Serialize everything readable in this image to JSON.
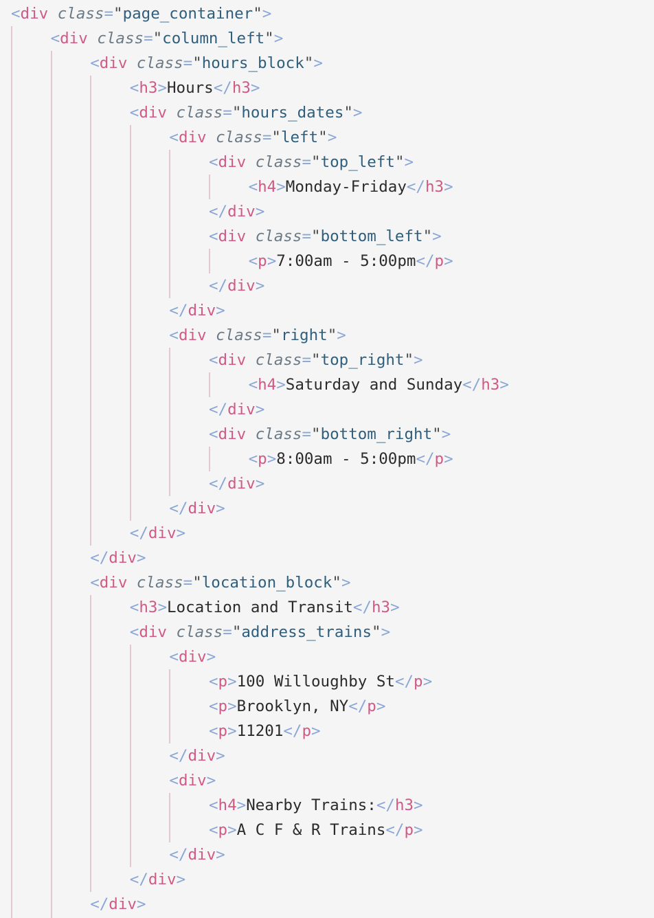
{
  "lines": [
    {
      "indent": 0,
      "tokens": [
        [
          "p",
          "<"
        ],
        [
          "t",
          "div"
        ],
        [
          "x",
          " "
        ],
        [
          "a",
          "class"
        ],
        [
          "p",
          "="
        ],
        [
          "q",
          "\""
        ],
        [
          "v",
          "page_container"
        ],
        [
          "q",
          "\""
        ],
        [
          "p",
          ">"
        ]
      ]
    },
    {
      "indent": 1,
      "tokens": [
        [
          "p",
          "<"
        ],
        [
          "t",
          "div"
        ],
        [
          "x",
          " "
        ],
        [
          "a",
          "class"
        ],
        [
          "p",
          "="
        ],
        [
          "q",
          "\""
        ],
        [
          "v",
          "column_left"
        ],
        [
          "q",
          "\""
        ],
        [
          "p",
          ">"
        ]
      ]
    },
    {
      "indent": 2,
      "tokens": [
        [
          "p",
          "<"
        ],
        [
          "t",
          "div"
        ],
        [
          "x",
          " "
        ],
        [
          "a",
          "class"
        ],
        [
          "p",
          "="
        ],
        [
          "q",
          "\""
        ],
        [
          "v",
          "hours_block"
        ],
        [
          "q",
          "\""
        ],
        [
          "p",
          ">"
        ]
      ]
    },
    {
      "indent": 3,
      "tokens": [
        [
          "p",
          "<"
        ],
        [
          "t",
          "h3"
        ],
        [
          "p",
          ">"
        ],
        [
          "x",
          "Hours"
        ],
        [
          "p",
          "</"
        ],
        [
          "t",
          "h3"
        ],
        [
          "p",
          ">"
        ]
      ]
    },
    {
      "indent": 3,
      "tokens": [
        [
          "p",
          "<"
        ],
        [
          "t",
          "div"
        ],
        [
          "x",
          " "
        ],
        [
          "a",
          "class"
        ],
        [
          "p",
          "="
        ],
        [
          "q",
          "\""
        ],
        [
          "v",
          "hours_dates"
        ],
        [
          "q",
          "\""
        ],
        [
          "p",
          ">"
        ]
      ]
    },
    {
      "indent": 4,
      "tokens": [
        [
          "p",
          "<"
        ],
        [
          "t",
          "div"
        ],
        [
          "x",
          " "
        ],
        [
          "a",
          "class"
        ],
        [
          "p",
          "="
        ],
        [
          "q",
          "\""
        ],
        [
          "v",
          "left"
        ],
        [
          "q",
          "\""
        ],
        [
          "p",
          ">"
        ]
      ]
    },
    {
      "indent": 5,
      "tokens": [
        [
          "p",
          "<"
        ],
        [
          "t",
          "div"
        ],
        [
          "x",
          " "
        ],
        [
          "a",
          "class"
        ],
        [
          "p",
          "="
        ],
        [
          "q",
          "\""
        ],
        [
          "v",
          "top_left"
        ],
        [
          "q",
          "\""
        ],
        [
          "p",
          ">"
        ]
      ]
    },
    {
      "indent": 6,
      "tokens": [
        [
          "p",
          "<"
        ],
        [
          "t",
          "h4"
        ],
        [
          "p",
          ">"
        ],
        [
          "x",
          "Monday-Friday"
        ],
        [
          "p",
          "</"
        ],
        [
          "t",
          "h3"
        ],
        [
          "p",
          ">"
        ]
      ]
    },
    {
      "indent": 5,
      "tokens": [
        [
          "p",
          "</"
        ],
        [
          "t",
          "div"
        ],
        [
          "p",
          ">"
        ]
      ]
    },
    {
      "indent": 5,
      "tokens": [
        [
          "p",
          "<"
        ],
        [
          "t",
          "div"
        ],
        [
          "x",
          " "
        ],
        [
          "a",
          "class"
        ],
        [
          "p",
          "="
        ],
        [
          "q",
          "\""
        ],
        [
          "v",
          "bottom_left"
        ],
        [
          "q",
          "\""
        ],
        [
          "p",
          ">"
        ]
      ]
    },
    {
      "indent": 6,
      "tokens": [
        [
          "p",
          "<"
        ],
        [
          "t",
          "p"
        ],
        [
          "p",
          ">"
        ],
        [
          "x",
          "7:00am - 5:00pm"
        ],
        [
          "p",
          "</"
        ],
        [
          "t",
          "p"
        ],
        [
          "p",
          ">"
        ]
      ]
    },
    {
      "indent": 5,
      "tokens": [
        [
          "p",
          "</"
        ],
        [
          "t",
          "div"
        ],
        [
          "p",
          ">"
        ]
      ]
    },
    {
      "indent": 4,
      "tokens": [
        [
          "p",
          "</"
        ],
        [
          "t",
          "div"
        ],
        [
          "p",
          ">"
        ]
      ]
    },
    {
      "indent": 4,
      "tokens": [
        [
          "p",
          "<"
        ],
        [
          "t",
          "div"
        ],
        [
          "x",
          " "
        ],
        [
          "a",
          "class"
        ],
        [
          "p",
          "="
        ],
        [
          "q",
          "\""
        ],
        [
          "v",
          "right"
        ],
        [
          "q",
          "\""
        ],
        [
          "p",
          ">"
        ]
      ]
    },
    {
      "indent": 5,
      "tokens": [
        [
          "p",
          "<"
        ],
        [
          "t",
          "div"
        ],
        [
          "x",
          " "
        ],
        [
          "a",
          "class"
        ],
        [
          "p",
          "="
        ],
        [
          "q",
          "\""
        ],
        [
          "v",
          "top_right"
        ],
        [
          "q",
          "\""
        ],
        [
          "p",
          ">"
        ]
      ]
    },
    {
      "indent": 6,
      "tokens": [
        [
          "p",
          "<"
        ],
        [
          "t",
          "h4"
        ],
        [
          "p",
          ">"
        ],
        [
          "x",
          "Saturday and Sunday"
        ],
        [
          "p",
          "</"
        ],
        [
          "t",
          "h3"
        ],
        [
          "p",
          ">"
        ]
      ]
    },
    {
      "indent": 5,
      "tokens": [
        [
          "p",
          "</"
        ],
        [
          "t",
          "div"
        ],
        [
          "p",
          ">"
        ]
      ]
    },
    {
      "indent": 5,
      "tokens": [
        [
          "p",
          "<"
        ],
        [
          "t",
          "div"
        ],
        [
          "x",
          " "
        ],
        [
          "a",
          "class"
        ],
        [
          "p",
          "="
        ],
        [
          "q",
          "\""
        ],
        [
          "v",
          "bottom_right"
        ],
        [
          "q",
          "\""
        ],
        [
          "p",
          ">"
        ]
      ]
    },
    {
      "indent": 6,
      "tokens": [
        [
          "p",
          "<"
        ],
        [
          "t",
          "p"
        ],
        [
          "p",
          ">"
        ],
        [
          "x",
          "8:00am - 5:00pm"
        ],
        [
          "p",
          "</"
        ],
        [
          "t",
          "p"
        ],
        [
          "p",
          ">"
        ]
      ]
    },
    {
      "indent": 5,
      "tokens": [
        [
          "p",
          "</"
        ],
        [
          "t",
          "div"
        ],
        [
          "p",
          ">"
        ]
      ]
    },
    {
      "indent": 4,
      "tokens": [
        [
          "p",
          "</"
        ],
        [
          "t",
          "div"
        ],
        [
          "p",
          ">"
        ]
      ]
    },
    {
      "indent": 3,
      "tokens": [
        [
          "p",
          "</"
        ],
        [
          "t",
          "div"
        ],
        [
          "p",
          ">"
        ]
      ]
    },
    {
      "indent": 2,
      "tokens": [
        [
          "p",
          "</"
        ],
        [
          "t",
          "div"
        ],
        [
          "p",
          ">"
        ]
      ]
    },
    {
      "indent": 2,
      "tokens": [
        [
          "p",
          "<"
        ],
        [
          "t",
          "div"
        ],
        [
          "x",
          " "
        ],
        [
          "a",
          "class"
        ],
        [
          "p",
          "="
        ],
        [
          "q",
          "\""
        ],
        [
          "v",
          "location_block"
        ],
        [
          "q",
          "\""
        ],
        [
          "p",
          ">"
        ]
      ]
    },
    {
      "indent": 3,
      "tokens": [
        [
          "p",
          "<"
        ],
        [
          "t",
          "h3"
        ],
        [
          "p",
          ">"
        ],
        [
          "x",
          "Location and Transit"
        ],
        [
          "p",
          "</"
        ],
        [
          "t",
          "h3"
        ],
        [
          "p",
          ">"
        ]
      ]
    },
    {
      "indent": 3,
      "tokens": [
        [
          "p",
          "<"
        ],
        [
          "t",
          "div"
        ],
        [
          "x",
          " "
        ],
        [
          "a",
          "class"
        ],
        [
          "p",
          "="
        ],
        [
          "q",
          "\""
        ],
        [
          "v",
          "address_trains"
        ],
        [
          "q",
          "\""
        ],
        [
          "p",
          ">"
        ]
      ]
    },
    {
      "indent": 4,
      "tokens": [
        [
          "p",
          "<"
        ],
        [
          "t",
          "div"
        ],
        [
          "p",
          ">"
        ]
      ]
    },
    {
      "indent": 5,
      "tokens": [
        [
          "p",
          "<"
        ],
        [
          "t",
          "p"
        ],
        [
          "p",
          ">"
        ],
        [
          "x",
          "100 Willoughby St"
        ],
        [
          "p",
          "</"
        ],
        [
          "t",
          "p"
        ],
        [
          "p",
          ">"
        ]
      ]
    },
    {
      "indent": 5,
      "tokens": [
        [
          "p",
          "<"
        ],
        [
          "t",
          "p"
        ],
        [
          "p",
          ">"
        ],
        [
          "x",
          "Brooklyn, NY"
        ],
        [
          "p",
          "</"
        ],
        [
          "t",
          "p"
        ],
        [
          "p",
          ">"
        ]
      ]
    },
    {
      "indent": 5,
      "tokens": [
        [
          "p",
          "<"
        ],
        [
          "t",
          "p"
        ],
        [
          "p",
          ">"
        ],
        [
          "x",
          "11201"
        ],
        [
          "p",
          "</"
        ],
        [
          "t",
          "p"
        ],
        [
          "p",
          ">"
        ]
      ]
    },
    {
      "indent": 4,
      "tokens": [
        [
          "p",
          "</"
        ],
        [
          "t",
          "div"
        ],
        [
          "p",
          ">"
        ]
      ]
    },
    {
      "indent": 4,
      "tokens": [
        [
          "p",
          "<"
        ],
        [
          "t",
          "div"
        ],
        [
          "p",
          ">"
        ]
      ]
    },
    {
      "indent": 5,
      "tokens": [
        [
          "p",
          "<"
        ],
        [
          "t",
          "h4"
        ],
        [
          "p",
          ">"
        ],
        [
          "x",
          "Nearby Trains:"
        ],
        [
          "p",
          "</"
        ],
        [
          "t",
          "h3"
        ],
        [
          "p",
          ">"
        ]
      ]
    },
    {
      "indent": 5,
      "tokens": [
        [
          "p",
          "<"
        ],
        [
          "t",
          "p"
        ],
        [
          "p",
          ">"
        ],
        [
          "x",
          "A C F & R Trains"
        ],
        [
          "p",
          "</"
        ],
        [
          "t",
          "p"
        ],
        [
          "p",
          ">"
        ]
      ]
    },
    {
      "indent": 4,
      "tokens": [
        [
          "p",
          "</"
        ],
        [
          "t",
          "div"
        ],
        [
          "p",
          ">"
        ]
      ]
    },
    {
      "indent": 3,
      "tokens": [
        [
          "p",
          "</"
        ],
        [
          "t",
          "div"
        ],
        [
          "p",
          ">"
        ]
      ]
    },
    {
      "indent": 2,
      "tokens": [
        [
          "p",
          "</"
        ],
        [
          "t",
          "div"
        ],
        [
          "p",
          ">"
        ]
      ]
    }
  ]
}
